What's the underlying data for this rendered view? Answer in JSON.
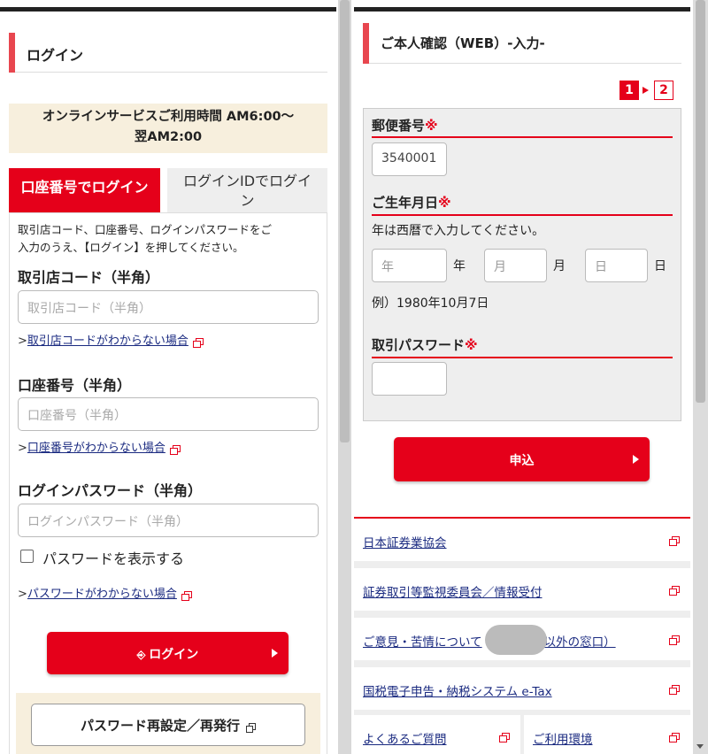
{
  "login": {
    "title": "ログイン",
    "notice_line1": "オンラインサービスご利用時間 AM6:00〜",
    "notice_line2": "翌AM2:00",
    "tab_account": "口座番号でログイン",
    "tab_loginid_line1": "ログインIDでログイ",
    "tab_loginid_line2": "ン",
    "intro_line1": "取引店コード、口座番号、ログインパスワードをご",
    "intro_line2": "入力のうえ、【ログイン】を押してください。",
    "branch_label": "取引店コード（半角）",
    "branch_placeholder": "取引店コード（半角）",
    "branch_help_prefix": ">",
    "branch_help": "取引店コードがわからない場合",
    "account_label": "口座番号（半角）",
    "account_placeholder": "口座番号（半角）",
    "account_help_prefix": ">",
    "account_help": "口座番号がわからない場合",
    "password_label": "ログインパスワード（半角）",
    "password_placeholder": "ログインパスワード（半角）",
    "show_password": "パスワードを表示する",
    "password_help_prefix": ">",
    "password_help": "パスワードがわからない場合",
    "login_button": "ログイン",
    "reset_button": "パスワード再設定／再発行"
  },
  "verify": {
    "title": "ご本人確認（WEB）-入力-",
    "step1": "1",
    "step2": "2",
    "postal_label": "郵便番号",
    "required_mark": "※",
    "postal_value": "3540001",
    "birth_label": "ご生年月日",
    "birth_note": "年は西暦で入力してください。",
    "year_placeholder": "年",
    "year_unit": "年",
    "month_placeholder": "月",
    "month_unit": "月",
    "day_placeholder": "日",
    "day_unit": "日",
    "example": "例）1980年10月7日",
    "trade_pw_label": "取引パスワード",
    "trade_pw_value": "",
    "apply_button": "申込"
  },
  "footer": {
    "links": [
      "日本証券業協会",
      "証券取引等監視委員会／情報受付",
      "ご意見・苦情について",
      "国税電子申告・納税システム e-Tax"
    ],
    "link3_tail": "以外の窓口）",
    "faq": "よくあるご質問",
    "env": "ご利用環境"
  },
  "colors": {
    "accent": "#e5001a",
    "notice_bg": "#f7efdd"
  }
}
